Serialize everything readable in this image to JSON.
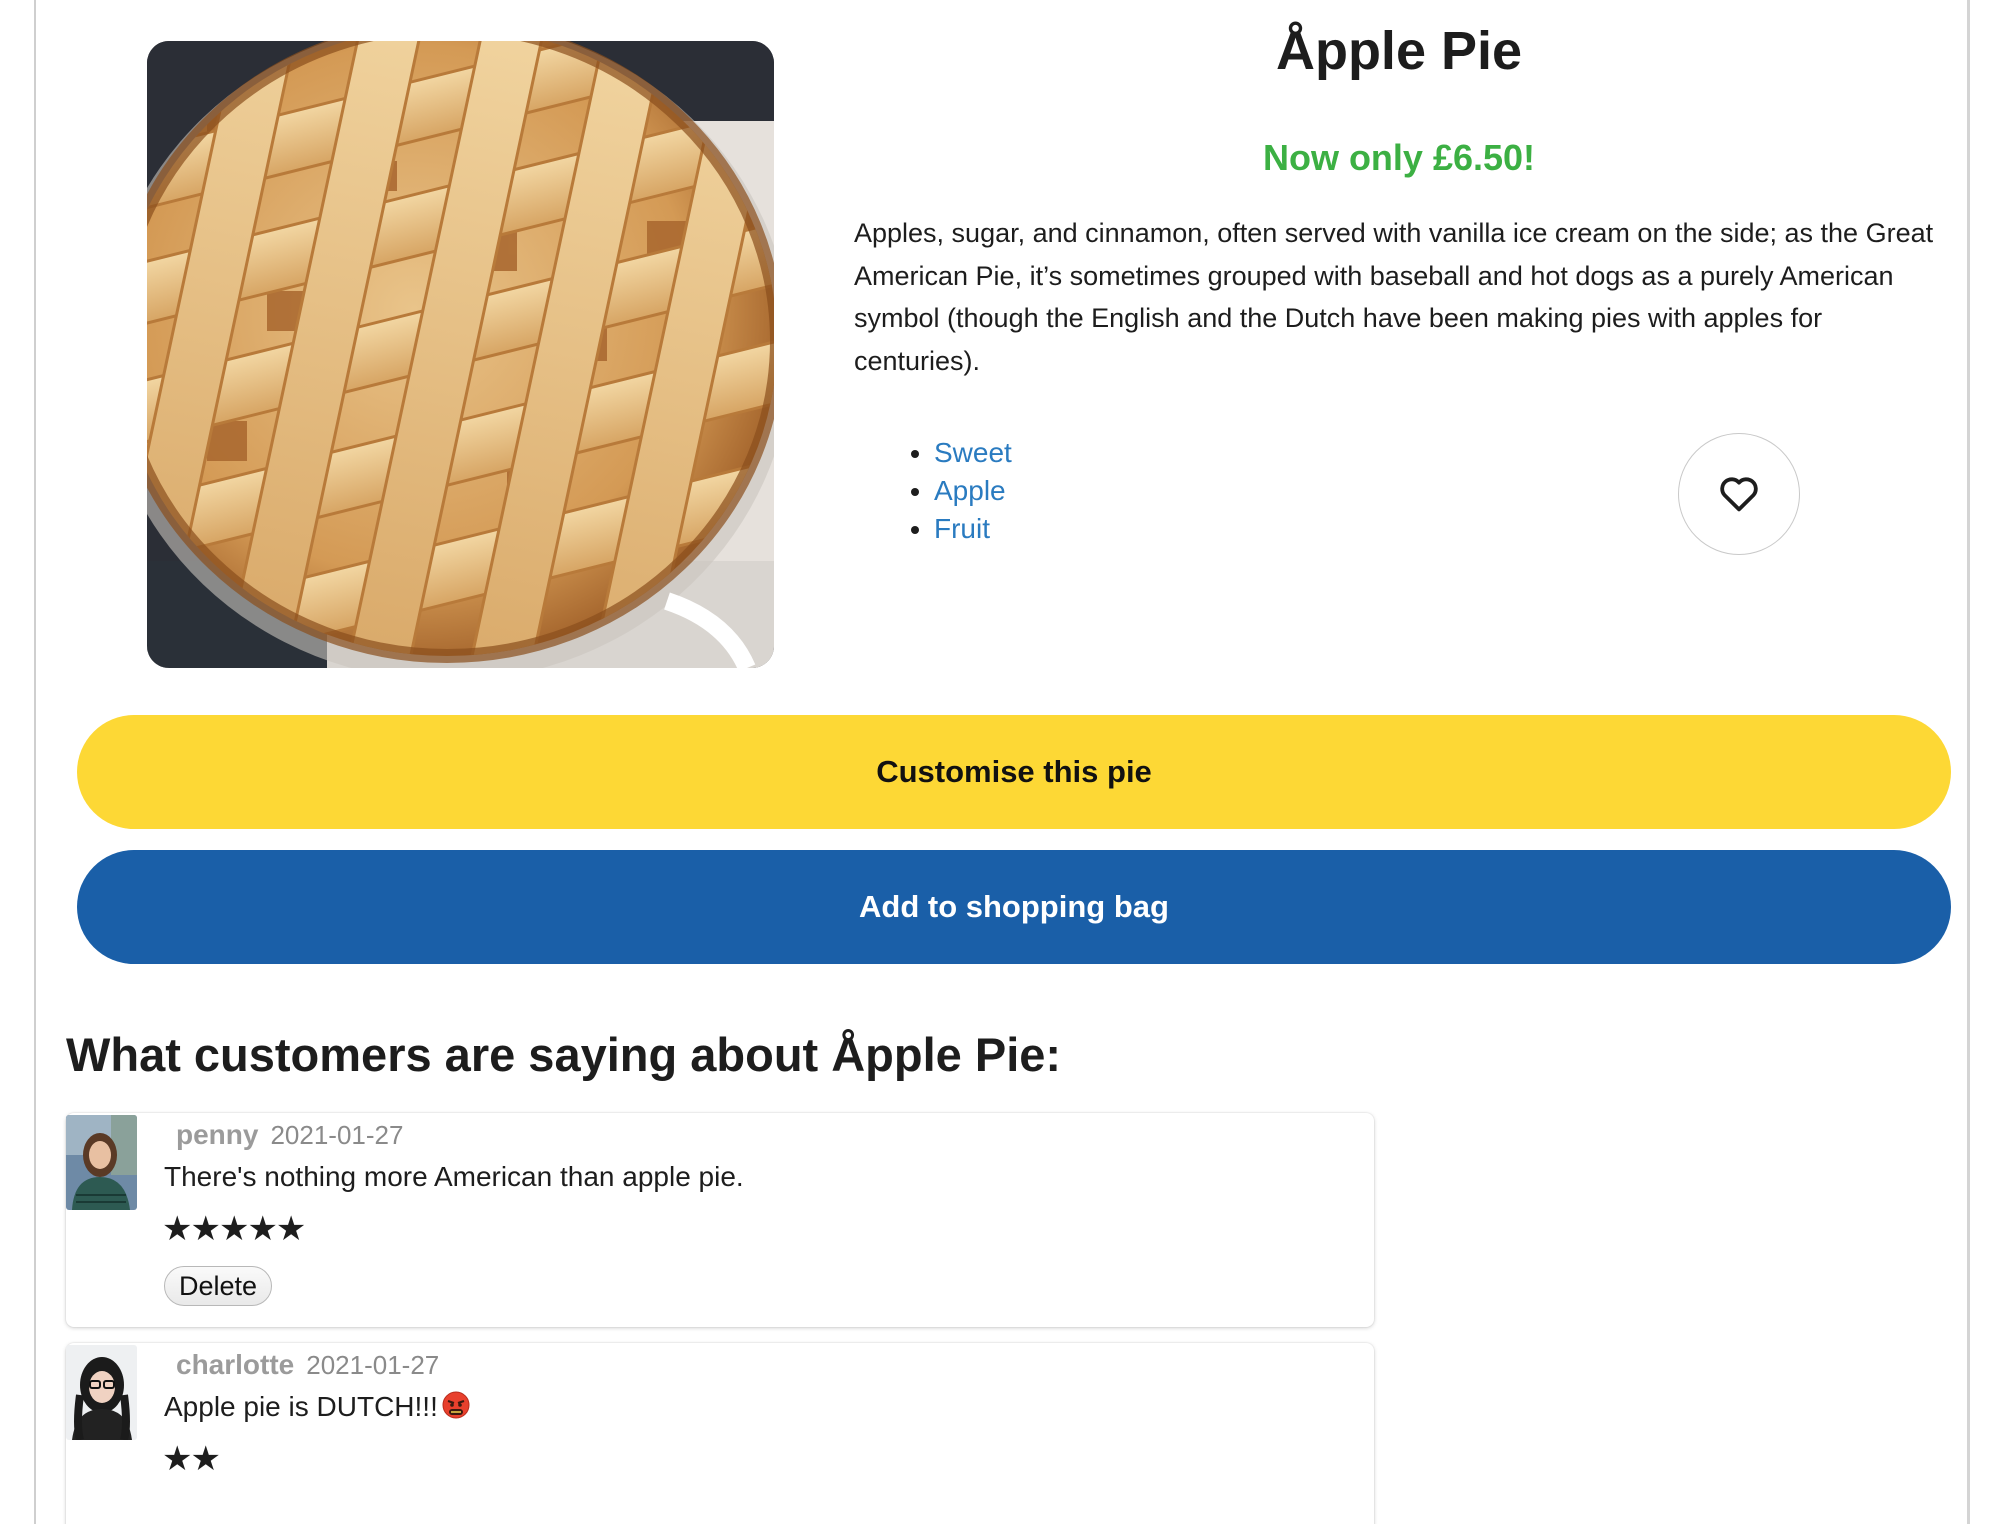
{
  "product": {
    "title": "Åpple Pie",
    "price_text": "Now only £6.50!",
    "description": "Apples, sugar, and cinnamon, often served with vanilla ice cream on the side; as the Great American Pie, it’s sometimes grouped with baseball and hot dogs as a purely American symbol (though the English and the Dutch have been making pies with apples for centuries).",
    "image_subject": "lattice-top apple pie in glass dish",
    "tags": [
      "Sweet",
      "Apple",
      "Fruit"
    ],
    "favourite_icon": "heart-outline-icon"
  },
  "actions": {
    "customise_label": "Customise this pie",
    "add_to_bag_label": "Add to shopping bag"
  },
  "colors": {
    "price_green": "#3cb043",
    "tag_link_blue": "#2a7bc0",
    "customise_yellow": "#fdd835",
    "add_to_bag_blue": "#1a5fa8"
  },
  "reviews": {
    "heading": "What customers are saying about Åpple Pie:",
    "items": [
      {
        "author": "penny",
        "date": "2021-01-27",
        "text": "There's nothing more American than apple pie.",
        "rating": 5,
        "stars": "★★★★★",
        "delete_label": "Delete"
      },
      {
        "author": "charlotte",
        "date": "2021-01-27",
        "text": "Apple pie is DUTCH!!!",
        "emoji": "angry-face-with-symbols-icon",
        "rating": 2,
        "stars": "★★"
      }
    ]
  }
}
